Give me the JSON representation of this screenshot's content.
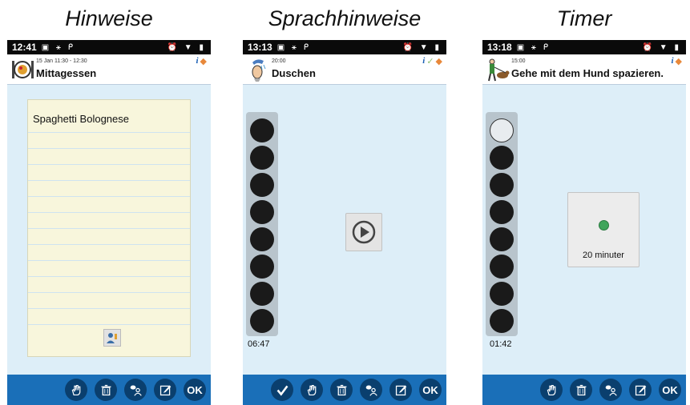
{
  "panels": [
    {
      "caption": "Hinweise",
      "status": {
        "time": "12:41"
      },
      "header": {
        "subtitle": "15 Jan 11:30 - 12:30",
        "title": "Mittagessen",
        "icon": "plate-icon"
      },
      "note": {
        "text": "Spaghetti Bolognese"
      },
      "toolbar": [
        "hand-icon",
        "trash-icon",
        "speech-person-icon",
        "edit-icon",
        "ok-button"
      ]
    },
    {
      "caption": "Sprachhinweise",
      "status": {
        "time": "13:13"
      },
      "header": {
        "subtitle": "20:00",
        "title": "Duschen",
        "icon": "shower-icon"
      },
      "timer": {
        "filled": 8,
        "empty": 0,
        "clock": "06:47"
      },
      "toolbar": [
        "check-icon",
        "hand-icon",
        "trash-icon",
        "speech-person-icon",
        "edit-icon",
        "ok-button"
      ]
    },
    {
      "caption": "Timer",
      "status": {
        "time": "13:18"
      },
      "header": {
        "subtitle": "15:00",
        "title": "Gehe mit dem Hund spazieren.",
        "icon": "dog-walk-icon"
      },
      "timer": {
        "filled": 7,
        "empty": 1,
        "clock": "01:42"
      },
      "timer_card": {
        "label": "20 minuter"
      },
      "toolbar": [
        "hand-icon",
        "trash-icon",
        "speech-person-icon",
        "edit-icon",
        "ok-button"
      ]
    }
  ],
  "toolbar_ok_label": "OK",
  "colors": {
    "toolbar": "#1a6fb8",
    "toolbar_button": "#0a3f6e",
    "screen_bg": "#ddeef8",
    "note_bg": "#f8f6dc",
    "timer_dot": "#1a1a1a",
    "timer_card_dot": "#3fa55b"
  }
}
